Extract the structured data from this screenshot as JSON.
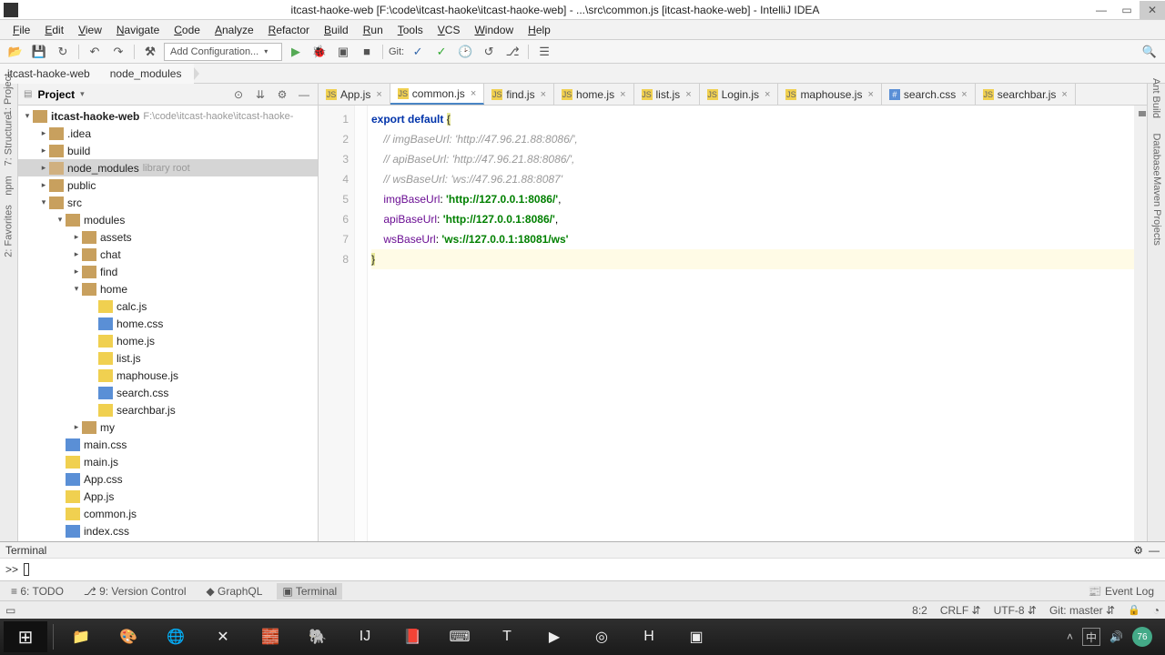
{
  "window": {
    "title": "itcast-haoke-web [F:\\code\\itcast-haoke\\itcast-haoke-web] - ...\\src\\common.js [itcast-haoke-web] - IntelliJ IDEA"
  },
  "menus": [
    "File",
    "Edit",
    "View",
    "Navigate",
    "Code",
    "Analyze",
    "Refactor",
    "Build",
    "Run",
    "Tools",
    "VCS",
    "Window",
    "Help"
  ],
  "toolbar": {
    "config": "Add Configuration...",
    "git_label": "Git:"
  },
  "breadcrumbs": [
    "itcast-haoke-web",
    "node_modules"
  ],
  "project": {
    "title": "Project",
    "root": {
      "name": "itcast-haoke-web",
      "hint": "F:\\code\\itcast-haoke\\itcast-haoke-"
    },
    "tree": [
      {
        "d": 1,
        "t": "folder",
        "a": "right",
        "label": ".idea"
      },
      {
        "d": 1,
        "t": "folder",
        "a": "right",
        "label": "build"
      },
      {
        "d": 1,
        "t": "folder",
        "a": "right",
        "label": "node_modules",
        "hint": "library root",
        "sel": true
      },
      {
        "d": 1,
        "t": "folder",
        "a": "right",
        "label": "public"
      },
      {
        "d": 1,
        "t": "folder",
        "a": "down",
        "label": "src"
      },
      {
        "d": 2,
        "t": "folder",
        "a": "down",
        "label": "modules"
      },
      {
        "d": 3,
        "t": "folder",
        "a": "right",
        "label": "assets"
      },
      {
        "d": 3,
        "t": "folder",
        "a": "right",
        "label": "chat"
      },
      {
        "d": 3,
        "t": "folder",
        "a": "right",
        "label": "find"
      },
      {
        "d": 3,
        "t": "folder",
        "a": "down",
        "label": "home"
      },
      {
        "d": 4,
        "t": "js",
        "a": "none",
        "label": "calc.js"
      },
      {
        "d": 4,
        "t": "css",
        "a": "none",
        "label": "home.css"
      },
      {
        "d": 4,
        "t": "js",
        "a": "none",
        "label": "home.js"
      },
      {
        "d": 4,
        "t": "js",
        "a": "none",
        "label": "list.js"
      },
      {
        "d": 4,
        "t": "js",
        "a": "none",
        "label": "maphouse.js"
      },
      {
        "d": 4,
        "t": "css",
        "a": "none",
        "label": "search.css"
      },
      {
        "d": 4,
        "t": "js",
        "a": "none",
        "label": "searchbar.js"
      },
      {
        "d": 3,
        "t": "folder",
        "a": "right",
        "label": "my"
      },
      {
        "d": 2,
        "t": "css",
        "a": "none",
        "label": "main.css"
      },
      {
        "d": 2,
        "t": "js",
        "a": "none",
        "label": "main.js"
      },
      {
        "d": 2,
        "t": "css",
        "a": "none",
        "label": "App.css"
      },
      {
        "d": 2,
        "t": "js",
        "a": "none",
        "label": "App.js"
      },
      {
        "d": 2,
        "t": "js",
        "a": "none",
        "label": "common.js"
      },
      {
        "d": 2,
        "t": "css",
        "a": "none",
        "label": "index.css"
      }
    ]
  },
  "left_tools": [
    "1: Project",
    "7: Structure",
    "npm",
    "2: Favorites"
  ],
  "right_tools": [
    "Ant Build",
    "Database",
    "Maven Projects"
  ],
  "tabs": [
    {
      "icon": "js",
      "name": "App.js"
    },
    {
      "icon": "js",
      "name": "common.js",
      "active": true
    },
    {
      "icon": "js",
      "name": "find.js"
    },
    {
      "icon": "js",
      "name": "home.js"
    },
    {
      "icon": "js",
      "name": "list.js"
    },
    {
      "icon": "js",
      "name": "Login.js"
    },
    {
      "icon": "js",
      "name": "maphouse.js"
    },
    {
      "icon": "css",
      "name": "search.css"
    },
    {
      "icon": "js",
      "name": "searchbar.js"
    }
  ],
  "code": {
    "l1a": "export",
    "l1b": "default",
    "l1c": "{",
    "l2": "    // imgBaseUrl: 'http://47.96.21.88:8086/',",
    "l3": "    // apiBaseUrl: 'http://47.96.21.88:8086/',",
    "l4": "    // wsBaseUrl: 'ws://47.96.21.88:8087'",
    "l5p": "imgBaseUrl",
    "l5v": "'http://127.0.0.1:8086/'",
    "l6p": "apiBaseUrl",
    "l6v": "'http://127.0.0.1:8086/'",
    "l7p": "wsBaseUrl",
    "l7v": "'ws://127.0.0.1:18081/ws'",
    "l8": "}"
  },
  "line_numbers": [
    "1",
    "2",
    "3",
    "4",
    "5",
    "6",
    "7",
    "8"
  ],
  "terminal": {
    "title": "Terminal",
    "prompt": ">>"
  },
  "bottom_tools": {
    "todo": "6: TODO",
    "vc": "9: Version Control",
    "gql": "GraphQL",
    "term": "Terminal",
    "eventlog": "Event Log"
  },
  "status": {
    "pos": "8:2",
    "crlf": "CRLF",
    "enc": "UTF-8",
    "git": "Git: master"
  },
  "taskbar": {
    "apps": [
      "⊞",
      "📁",
      "🎨",
      "🌐",
      "✕",
      "🧱",
      "🐘",
      "IJ",
      "📕",
      "⌨",
      "T",
      "▶",
      "◎",
      "H",
      "▣"
    ],
    "tray": {
      "ime": "中",
      "batt": "76"
    }
  }
}
